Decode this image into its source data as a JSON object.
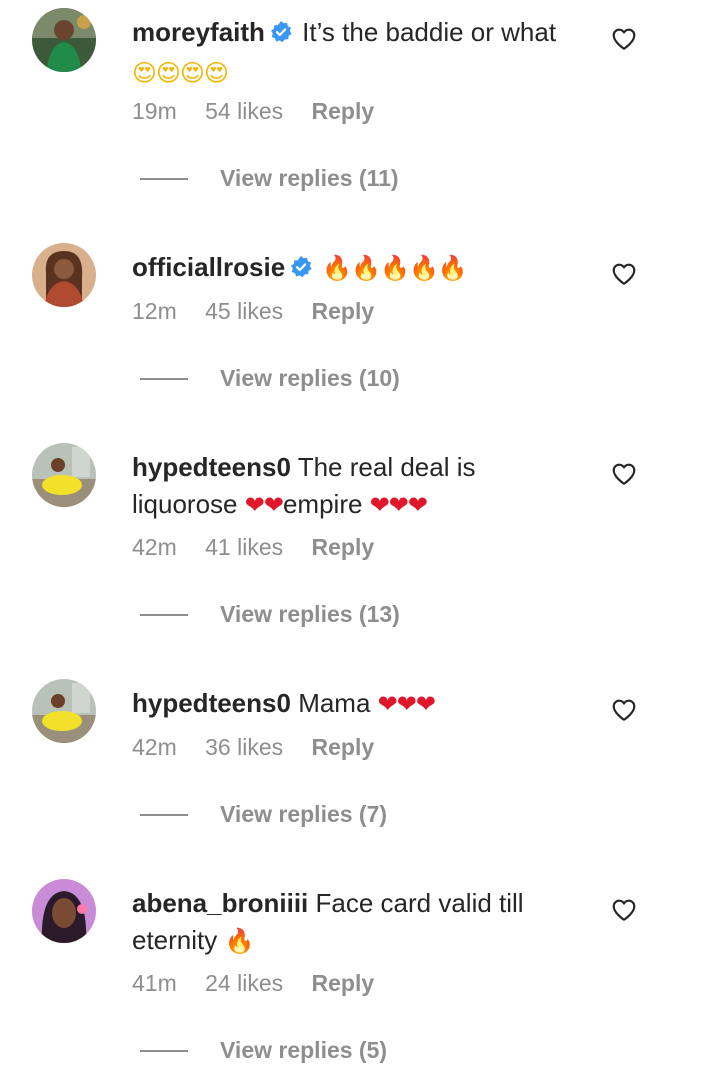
{
  "comments": [
    {
      "username": "moreyfaith",
      "verified": true,
      "text": "It’s the baddie or what",
      "emojis": "😍😍😍😍",
      "time": "19m",
      "likes": "54 likes",
      "reply": "Reply",
      "view_replies": "View replies (11)"
    },
    {
      "username": "officiallrosie",
      "verified": true,
      "text": "",
      "emojis": "🔥🔥🔥🔥🔥",
      "time": "12m",
      "likes": "45 likes",
      "reply": "Reply",
      "view_replies": "View replies (10)"
    },
    {
      "username": "hypedteens0",
      "verified": false,
      "text": "The real deal is liquorose",
      "emojis_a": "❤❤",
      "text_b": "empire",
      "emojis_b": "❤❤❤",
      "time": "42m",
      "likes": "41 likes",
      "reply": "Reply",
      "view_replies": "View replies (13)"
    },
    {
      "username": "hypedteens0",
      "verified": false,
      "text": "Mama",
      "emojis": "❤❤❤",
      "time": "42m",
      "likes": "36 likes",
      "reply": "Reply",
      "view_replies": "View replies (7)"
    },
    {
      "username": "abena_broniiii",
      "verified": false,
      "text": "Face card valid till eternity",
      "emojis": "🔥",
      "time": "41m",
      "likes": "24 likes",
      "reply": "Reply",
      "view_replies": "View replies (5)"
    }
  ],
  "colors": {
    "text": "#262626",
    "muted": "#8e8e8e",
    "verified": "#3897f0",
    "heart": "#e0162b",
    "fire": "#ff6a00"
  },
  "icons": {
    "like": "heart-outline-icon",
    "verified": "verified-badge-icon"
  }
}
